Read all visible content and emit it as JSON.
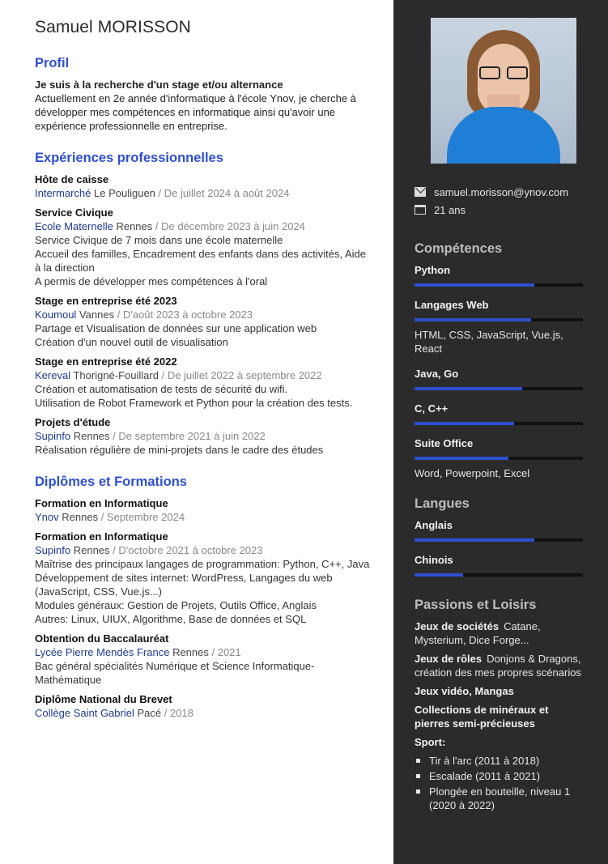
{
  "header": {
    "first_name": "Samuel",
    "last_name": "MORISSON"
  },
  "profile": {
    "title": "Profil",
    "headline": "Je suis à la recherche d'un stage et/ou alternance",
    "text": "Actuellement en 2e année d'informatique à l'école Ynov, je cherche à développer mes compétences en informatique ainsi qu'avoir une expérience professionnelle en entreprise."
  },
  "experience": {
    "title": "Expériences professionnelles",
    "items": [
      {
        "role": "Hôte de caisse",
        "org": "Intermarché",
        "loc": "Le Pouliguen",
        "date": "/ De juillet 2024 à août 2024",
        "desc": []
      },
      {
        "role": "Service Civique",
        "org": "Ecole Maternelle",
        "loc": "Rennes",
        "date": "/ De décembre 2023 à juin 2024",
        "desc": [
          "Service Civique de 7 mois dans une école maternelle",
          "Accueil des familles, Encadrement des enfants dans des activités, Aide à la direction",
          "A permis de développer mes compétences à l'oral"
        ]
      },
      {
        "role": "Stage en entreprise été 2023",
        "org": "Koumoul",
        "loc": "Vannes",
        "date": "/ D'août 2023 à octobre 2023",
        "desc": [
          "Partage et Visualisation de données sur une application web",
          "Création d'un nouvel outil de visualisation"
        ]
      },
      {
        "role": "Stage en entreprise été 2022",
        "org": "Kereval",
        "loc": "Thorigné-Fouillard",
        "date": "/ De juillet 2022 à septembre 2022",
        "desc": [
          "Création et automatisation de tests de sécurité du wifi.",
          "Utilisation de Robot Framework et Python pour la création des tests."
        ]
      },
      {
        "role": "Projets d'étude",
        "org": "Supinfo",
        "loc": "Rennes",
        "date": "/ De septembre 2021 à juin 2022",
        "desc": [
          "Réalisation régulière de mini-projets dans le cadre des études"
        ]
      }
    ]
  },
  "education": {
    "title": "Diplômes et Formations",
    "items": [
      {
        "degree": "Formation en Informatique",
        "org": "Ynov",
        "loc": "Rennes",
        "date": "/ Septembre 2024",
        "desc": []
      },
      {
        "degree": "Formation en Informatique",
        "org": "Supinfo",
        "loc": "Rennes",
        "date": "/ D'octobre 2021 à octobre 2023",
        "desc": [
          "Maîtrise des principaux langages de programmation: Python, C++, Java",
          "Développement de sites internet: WordPress, Langages du web (JavaScript, CSS, Vue.js...)",
          "Modules généraux: Gestion de Projets, Outils Office, Anglais",
          "Autres: Linux, UIUX, Algorithme, Base de données et SQL"
        ]
      },
      {
        "degree": "Obtention du Baccalauréat",
        "org": "Lycée Pierre Mendès France",
        "loc": "Rennes",
        "date": "/ 2021",
        "desc": [
          "Bac général spécialités Numérique et Science Informatique-Mathématique"
        ]
      },
      {
        "degree": "Diplôme National du Brevet",
        "org": "Collège Saint Gabriel",
        "loc": "Pacé",
        "date": "/ 2018",
        "desc": []
      }
    ]
  },
  "contact": {
    "email": "samuel.morisson@ynov.com",
    "age": "21 ans",
    "email_icon": "envelope-icon",
    "age_icon": "calendar-icon"
  },
  "skills": {
    "title": "Compétences",
    "items": [
      {
        "name": "Python",
        "level": 0.71,
        "note": ""
      },
      {
        "name": "Langages Web",
        "level": 0.69,
        "note": "HTML, CSS, JavaScript, Vue.js, React"
      },
      {
        "name": "Java, Go",
        "level": 0.64,
        "note": ""
      },
      {
        "name": "C, C++",
        "level": 0.59,
        "note": ""
      },
      {
        "name": "Suite Office",
        "level": 0.56,
        "note": "Word, Powerpoint, Excel"
      }
    ]
  },
  "languages": {
    "title": "Langues",
    "items": [
      {
        "name": "Anglais",
        "level": 0.71
      },
      {
        "name": "Chinois",
        "level": 0.29
      }
    ]
  },
  "hobbies": {
    "title": "Passions et Loisirs",
    "items": [
      {
        "label": "Jeux de sociétés",
        "text": "Catane, Mysterium, Dice Forge..."
      },
      {
        "label": "Jeux de rôles",
        "text": "Donjons & Dragons, création des mes propres scénarios"
      },
      {
        "label": "Jeux vidéo, Mangas",
        "text": ""
      },
      {
        "label": "Collections de minéraux et pierres semi-précieuses",
        "text": ""
      }
    ],
    "sport_label": "Sport:",
    "sports": [
      "Tir à l'arc (2011 à 2018)",
      "Escalade (2011 à 2021)",
      "Plongée en bouteille, niveau 1 (2020 à 2022)"
    ]
  },
  "colors": {
    "accent": "#2f4fd0",
    "sidebar": "#2b2b2b",
    "org": "#1d3b8e"
  }
}
